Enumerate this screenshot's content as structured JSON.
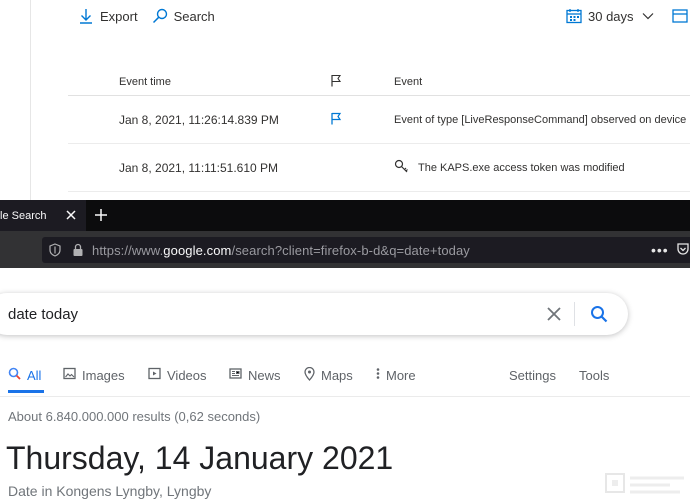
{
  "defender": {
    "toolbar": {
      "export_label": "Export",
      "search_label": "Search",
      "range_label": "30 days"
    },
    "table": {
      "col_time": "Event time",
      "col_event": "Event",
      "rows": [
        {
          "time": "Jan 8, 2021, 11:26:14.839 PM",
          "flagged": true,
          "icon": "flag-icon",
          "event": "Event of type [LiveResponseCommand] observed on device"
        },
        {
          "time": "Jan 8, 2021, 11:11:51.610 PM",
          "flagged": false,
          "icon": "key-icon",
          "event": "The KAPS.exe access token was modified"
        }
      ]
    }
  },
  "browser": {
    "tab_title": "le Search",
    "url_prefix": "https://www.",
    "url_host": "google.com",
    "url_rest": "/search?client=firefox-b-d&q=date+today",
    "menu_dots": "•••"
  },
  "google": {
    "query": "date today",
    "tabs": [
      {
        "label": "All",
        "icon": "search-icon",
        "active": true
      },
      {
        "label": "Images",
        "icon": "image-icon",
        "active": false
      },
      {
        "label": "Videos",
        "icon": "video-icon",
        "active": false
      },
      {
        "label": "News",
        "icon": "news-icon",
        "active": false
      },
      {
        "label": "Maps",
        "icon": "map-pin-icon",
        "active": false
      },
      {
        "label": "More",
        "icon": "more-vert-icon",
        "active": false
      }
    ],
    "settings_label": "Settings",
    "tools_label": "Tools",
    "result_stats": "About 6.840.000.000 results (0,62 seconds)",
    "answer_date": "Thursday, 14 January 2021",
    "answer_sub": "Date in Kongens Lyngby, Lyngby"
  },
  "colors": {
    "accent_blue": "#0078d4",
    "google_blue": "#1a73e8",
    "tab_dark": "#0c0c0d",
    "nav_gray": "#323234"
  }
}
